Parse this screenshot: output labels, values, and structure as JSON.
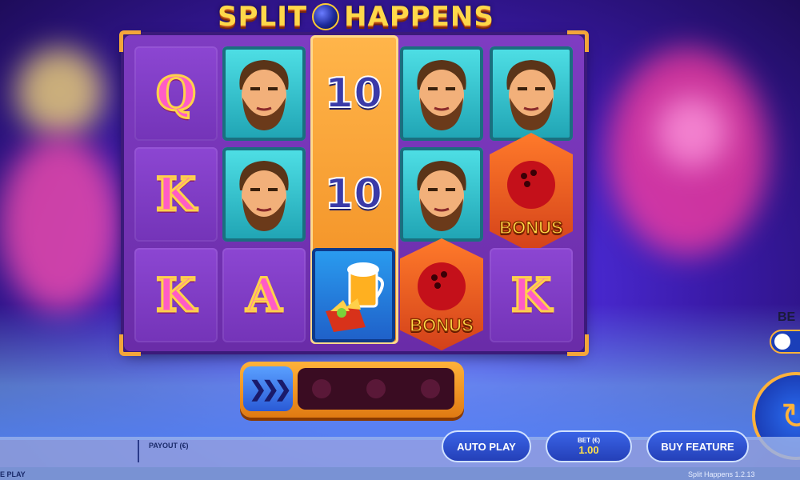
{
  "game": {
    "title_part1": "SPLIT",
    "title_part2": "HAPPENS",
    "version_text": "Split Happens  1.2.13"
  },
  "reels": [
    [
      "Q",
      "K",
      "K"
    ],
    [
      "face",
      "face",
      "A"
    ],
    [
      "10",
      "10",
      "beer-nachos"
    ],
    [
      "face",
      "face",
      "BONUS"
    ],
    [
      "face",
      "BONUS",
      "K"
    ]
  ],
  "symbols": {
    "bonus_label": "BONUS"
  },
  "hud": {
    "left_label": "E PLAY",
    "payout_label": "PAYOUT (€)",
    "auto_play": "AUTO PLAY",
    "bet_label": "BET (€)",
    "bet_value": "1.00",
    "buy_feature": "BUY FEATURE",
    "bet_edge_label": "BE"
  },
  "colors": {
    "accent_orange": "#ffb23a",
    "button_blue": "#2440b8",
    "bet_value_yellow": "#ffe04a",
    "board_purple": "#7f3cc2"
  }
}
